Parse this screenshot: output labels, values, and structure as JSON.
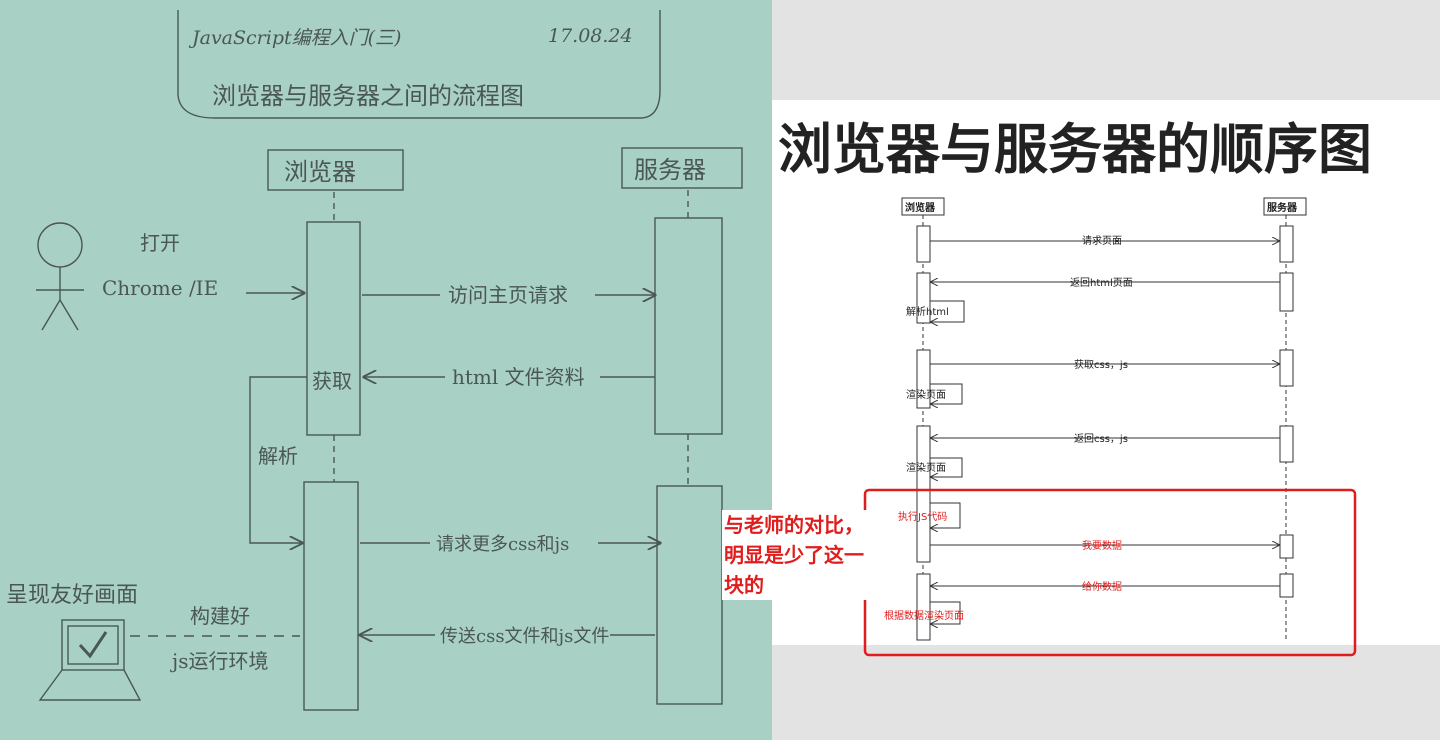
{
  "sketch": {
    "header_title": "JavaScript编程入门(三)",
    "header_date": "17.08.24",
    "header_subtitle": "浏览器与服务器之间的流程图",
    "browser_label": "浏览器",
    "server_label": "服务器",
    "user_action_1": "打开",
    "user_action_2": "Chrome /IE",
    "msg_request_home": "访问主页请求",
    "msg_html_data": "html 文件资料",
    "get_label": "获取",
    "parse_label": "解析",
    "msg_request_css_js": "请求更多css和js",
    "msg_send_css_js": "传送css文件和js文件",
    "render_label": "呈现友好画面",
    "build_label": "构建好",
    "js_env_label": "js运行环境"
  },
  "seq": {
    "title": "浏览器与服务器的顺序图",
    "browser": "浏览器",
    "server": "服务器",
    "msg1": "请求页面",
    "msg2": "返回html页面",
    "self1": "解析html",
    "msg3": "获取css，js",
    "self2": "渲染页面",
    "msg4": "返回css，js",
    "self3": "渲染页面",
    "self4": "执行JS代码",
    "msg5": "我要数据",
    "msg6": "给你数据",
    "self5": "根据数据渲染页面"
  },
  "annotation": {
    "note": "与老师的对比，明显是少了这一块的",
    "highlight_color": "#e01d1d"
  }
}
